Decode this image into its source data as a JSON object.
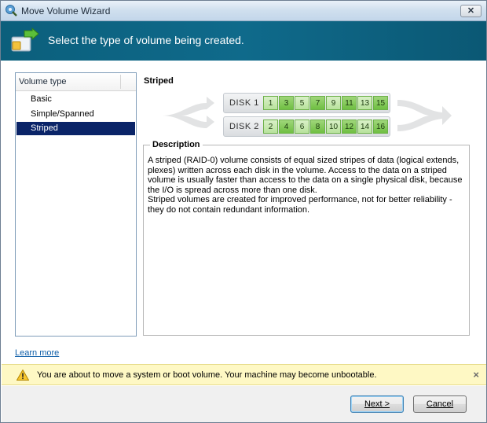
{
  "window": {
    "title": "Move Volume Wizard",
    "close_label": "✕"
  },
  "banner": {
    "title": "Select the type of volume being created."
  },
  "typelist": {
    "header": "Volume type",
    "items": [
      {
        "label": "Basic",
        "selected": false
      },
      {
        "label": "Simple/Spanned",
        "selected": false
      },
      {
        "label": "Striped",
        "selected": true
      }
    ]
  },
  "detail": {
    "title": "Striped",
    "disks": [
      {
        "label": "DISK 1",
        "stripes": [
          "1",
          "3",
          "5",
          "7",
          "9",
          "11",
          "13",
          "15"
        ]
      },
      {
        "label": "DISK 2",
        "stripes": [
          "2",
          "4",
          "6",
          "8",
          "10",
          "12",
          "14",
          "16"
        ]
      }
    ],
    "description_legend": "Description",
    "description_p1": "A striped (RAID-0) volume consists of equal sized stripes of data (logical extends, plexes) written across each disk in the volume. Access to the data on a striped volume is usually faster than access to the data on a single physical disk, because the I/O is spread across more than one disk.",
    "description_p2": "Striped volumes are created for improved performance, not for better reliability - they do not contain redundant information."
  },
  "learn_more": "Learn more",
  "warning": {
    "text": "You are about to move a system or boot volume. Your machine may become unbootable.",
    "close": "×"
  },
  "buttons": {
    "next": "Next >",
    "cancel": "Cancel"
  },
  "colors": {
    "banner": "#0f6a8b",
    "selection": "#0a2468",
    "stripe": "#6fbf42",
    "warning_bg": "#fef8c4",
    "link": "#0e5ea8"
  },
  "icons": {
    "app": "wizard-disk-icon",
    "banner": "move-volume-icon",
    "warning": "warning-icon"
  }
}
